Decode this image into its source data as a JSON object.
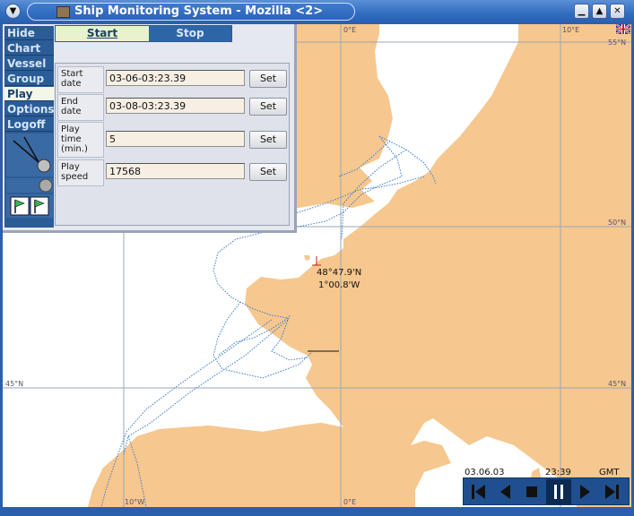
{
  "window": {
    "title": "Ship Monitoring System - Mozilla <2>"
  },
  "nav": {
    "items": [
      {
        "label": "Hide",
        "id": "hide"
      },
      {
        "label": "Chart",
        "id": "chart"
      },
      {
        "label": "Vessel",
        "id": "vessel"
      },
      {
        "label": "Group",
        "id": "group"
      },
      {
        "label": "Play",
        "id": "play",
        "active": true
      },
      {
        "label": "Options",
        "id": "options"
      },
      {
        "label": "Logoff",
        "id": "logoff"
      }
    ]
  },
  "play_tabs": {
    "start_label": "Start",
    "stop_label": "Stop"
  },
  "form": {
    "start_date": {
      "label": "Start date",
      "value": "03-06-03:23.39",
      "button": "Set"
    },
    "end_date": {
      "label": "End date",
      "value": "03-08-03:23.39",
      "button": "Set"
    },
    "play_time": {
      "label": "Play time (min.)",
      "value": "5",
      "button": "Set"
    },
    "play_speed": {
      "label": "Play speed",
      "value": "17568",
      "button": "Set"
    }
  },
  "map": {
    "grid_labels": {
      "lon_0_top": "0°E",
      "lon_10e_top": "10°E",
      "lat_55_right": "55°N",
      "lat_50_right": "50°N",
      "lat_45_left": "45°N",
      "lat_45_right": "45°N",
      "lon_10w_bottom": "10°W",
      "lon_0_bottom": "0°E"
    },
    "cursor_position": {
      "lat": "48°47.9'N",
      "lon": "1°00.8'W"
    },
    "colors": {
      "land": "#f6c78e",
      "sea": "#ffffff",
      "track": "#3b7bd1",
      "grid": "#9aa7b8",
      "cursor": "#d21f1f"
    }
  },
  "playback": {
    "date": "03.06.03",
    "time": "23:39",
    "timezone": "GMT"
  },
  "icons": {
    "window_menu": "chevron-down-icon",
    "minimize": "minimize-icon",
    "maximize": "maximize-icon",
    "close": "close-icon",
    "language": "uk-flag-icon"
  }
}
